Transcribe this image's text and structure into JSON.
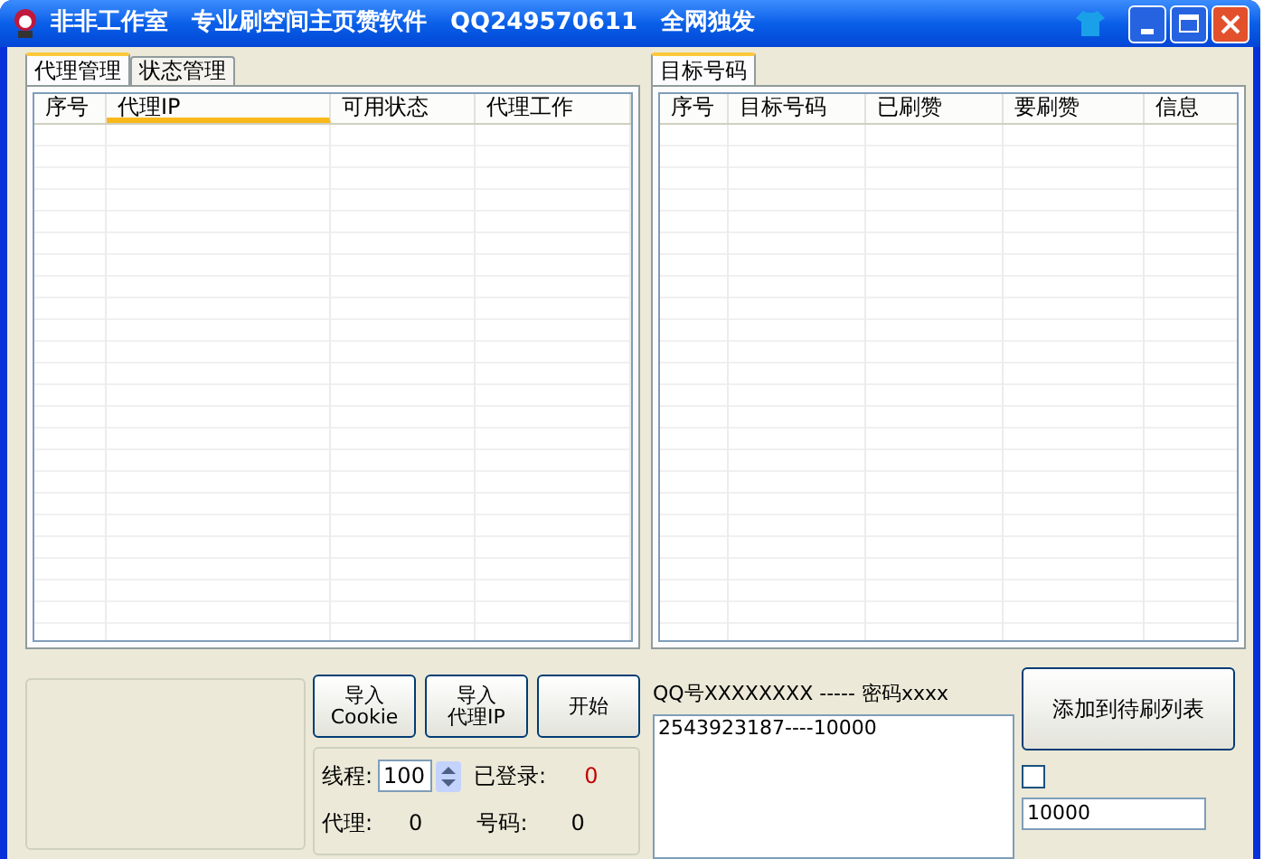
{
  "window": {
    "title": "非非工作室　专业刷空间主页赞软件　QQ249570611　全网独发"
  },
  "left_tabs": [
    {
      "label": "代理管理",
      "selected": true
    },
    {
      "label": "状态管理",
      "selected": false
    }
  ],
  "proxy_table": {
    "columns": [
      {
        "label": "序号",
        "highlighted": false
      },
      {
        "label": "代理IP",
        "highlighted": true
      },
      {
        "label": "可用状态",
        "highlighted": false
      },
      {
        "label": "代理工作",
        "highlighted": false
      }
    ]
  },
  "right_tabs": [
    {
      "label": "目标号码",
      "selected": true
    }
  ],
  "target_table": {
    "columns": [
      {
        "label": "序号"
      },
      {
        "label": "目标号码"
      },
      {
        "label": "已刷赞"
      },
      {
        "label": "要刷赞"
      },
      {
        "label": "信息"
      }
    ]
  },
  "buttons": [
    {
      "lines": [
        "导入",
        "Cookie"
      ]
    },
    {
      "lines": [
        "导入",
        "代理IP"
      ]
    },
    {
      "lines": [
        "开始"
      ]
    }
  ],
  "stats": {
    "threads_label": "线程:",
    "threads_value": "100",
    "logged_in_label": "已登录:",
    "logged_in_value": "0",
    "proxy_label": "代理:",
    "proxy_value": "0",
    "number_label": "号码:",
    "number_value": "0"
  },
  "format_hint": "QQ号XXXXXXXX ----- 密码xxxx",
  "accounts_text": "2543923187----10000",
  "add_button": "添加到待刷列表",
  "option": {
    "checked": false
  },
  "amount_field": "10000"
}
